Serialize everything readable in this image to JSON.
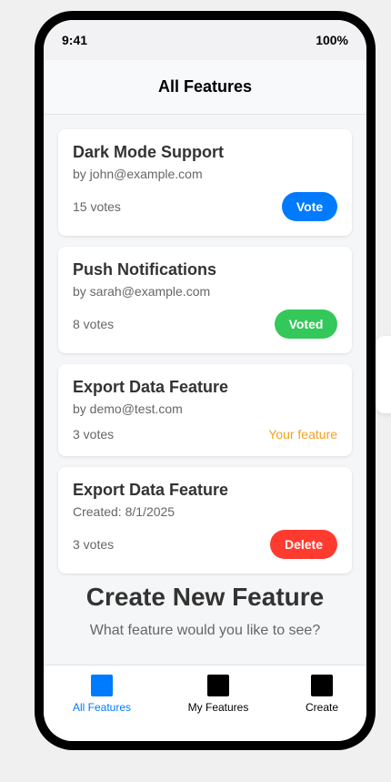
{
  "status_bar": {
    "time": "9:41",
    "battery": "100%"
  },
  "header": {
    "title": "All Features"
  },
  "cards": [
    {
      "title": "Dark Mode Support",
      "subtitle": "by john@example.com",
      "votes": "15 votes",
      "action": "Vote"
    },
    {
      "title": "Push Notifications",
      "subtitle": "by sarah@example.com",
      "votes": "8 votes",
      "action": "Voted"
    },
    {
      "title": "Export Data Feature",
      "subtitle": "by demo@test.com",
      "votes": "3 votes",
      "action": "Your feature"
    },
    {
      "title": "Export Data Feature",
      "subtitle": "Created: 8/1/2025",
      "votes": "3 votes",
      "action": "Delete"
    }
  ],
  "create": {
    "title": "Create New Feature",
    "subtitle": "What feature would you like to see?"
  },
  "tabbar": {
    "tabs": [
      {
        "label": "All Features",
        "icon": "all-features-icon",
        "active": true
      },
      {
        "label": "My Features",
        "icon": "my-features-icon",
        "active": false
      },
      {
        "label": "Create",
        "icon": "create-icon",
        "active": false
      }
    ]
  },
  "colors": {
    "primary": "#007aff",
    "success": "#34c759",
    "danger": "#ff3b30",
    "warning": "#f0a020",
    "active_tab": "#007aff",
    "inactive_icon": "#000000"
  }
}
